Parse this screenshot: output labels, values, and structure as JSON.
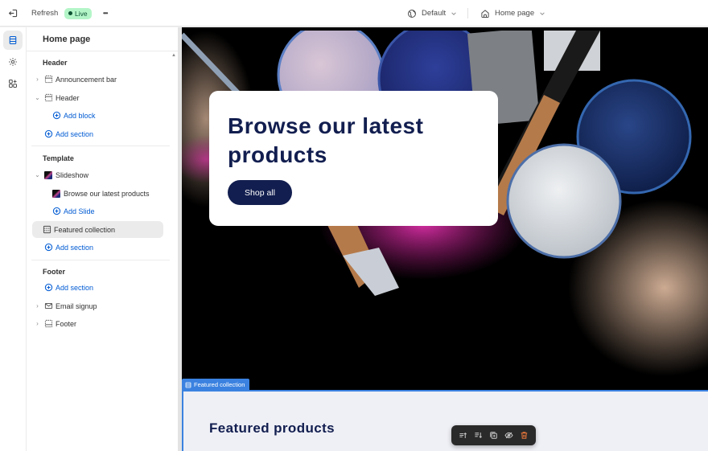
{
  "topbar": {
    "exit_icon": "exit-icon",
    "refresh_label": "Refresh",
    "live_badge": "Live",
    "more_icon": "more-horizontal-icon",
    "more_label": "•••",
    "theme_selector": {
      "icon": "globe-icon",
      "label": "Default"
    },
    "page_selector": {
      "icon": "home-icon",
      "label": "Home page"
    }
  },
  "rail": {
    "items": [
      {
        "name": "sections",
        "icon": "sections-icon",
        "active": true
      },
      {
        "name": "settings",
        "icon": "gear-icon",
        "active": false
      },
      {
        "name": "apps",
        "icon": "apps-icon",
        "active": false
      }
    ]
  },
  "panel": {
    "title": "Home page",
    "groups": {
      "header": {
        "label": "Header",
        "items": [
          {
            "label": "Announcement bar",
            "icon": "section-icon",
            "chevron": "right"
          },
          {
            "label": "Header",
            "icon": "section-icon",
            "chevron": "down"
          }
        ],
        "add_block": "Add block",
        "add_section": "Add section"
      },
      "template": {
        "label": "Template",
        "slideshow": "Slideshow",
        "slide": "Browse our latest products",
        "add_slide": "Add Slide",
        "featured_collection": "Featured collection",
        "add_section": "Add section"
      },
      "footer": {
        "label": "Footer",
        "add_section": "Add section",
        "items": [
          {
            "label": "Email signup",
            "icon": "email-icon",
            "chevron": "right"
          },
          {
            "label": "Footer",
            "icon": "footer-icon",
            "chevron": "right"
          }
        ]
      }
    }
  },
  "preview": {
    "hero": {
      "title": "Browse our latest products",
      "button": "Shop all"
    },
    "selected_section_tab": "Featured collection",
    "featured_title": "Featured products",
    "toolbar": [
      {
        "name": "move-up",
        "icon": "move-up-icon"
      },
      {
        "name": "move-down",
        "icon": "move-down-icon"
      },
      {
        "name": "duplicate",
        "icon": "duplicate-icon"
      },
      {
        "name": "hide",
        "icon": "hide-icon"
      },
      {
        "name": "delete",
        "icon": "trash-icon"
      }
    ]
  },
  "colors": {
    "accent": "#005bd3",
    "brand_navy": "#121e4f",
    "live_bg": "#b4f5c8",
    "selection_blue": "#3b82e0",
    "delete": "#e8763a"
  }
}
